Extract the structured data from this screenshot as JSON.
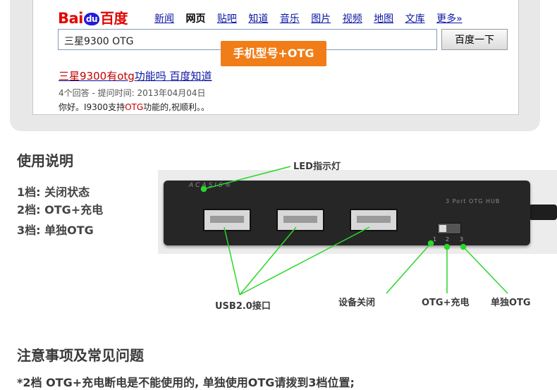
{
  "browser": {
    "logo_prefix": "Bai",
    "logo_paw": "du",
    "logo_cn": "百度",
    "nav": [
      "新闻",
      "网页",
      "贴吧",
      "知道",
      "音乐",
      "图片",
      "视频",
      "地图",
      "文库",
      "更多»"
    ],
    "search_value": "三星9300   OTG",
    "search_button": "百度一下",
    "callout": "手机型号+OTG",
    "result": {
      "title_pre": "三星9300",
      "title_hl": "有otg",
      "title_post": "功能吗  百度知道",
      "meta": "4个回答 - 提问时间: 2013年04月04日",
      "snippet_pre": "你好。I9300支持",
      "snippet_hl": "OTG",
      "snippet_post": "功能的,祝顺利。。"
    }
  },
  "usage": {
    "heading": "使用说明",
    "modes": [
      "1档: 关闭状态",
      "2档: OTG+充电",
      "3档: 单独OTG"
    ]
  },
  "hub": {
    "brand": "ACASIS®",
    "label": "3 Port  OTG HUB",
    "switch_numbers": [
      "1",
      "2",
      "3"
    ],
    "callouts": {
      "led": "LED指示灯",
      "usb": "USB2.0接口",
      "off": "设备关闭",
      "otg_charge": "OTG+充电",
      "otg_only": "单独OTG"
    }
  },
  "faq": {
    "heading": "注意事项及常见问题",
    "note": "*2档 OTG+充电断电是不能使用的, 单独使用OTG请拨到3档位置;"
  },
  "colors": {
    "accent_orange": "#f07d17",
    "pointer_green": "#2bd62b",
    "link_blue": "#0b16a3",
    "highlight_red": "#c00000"
  }
}
